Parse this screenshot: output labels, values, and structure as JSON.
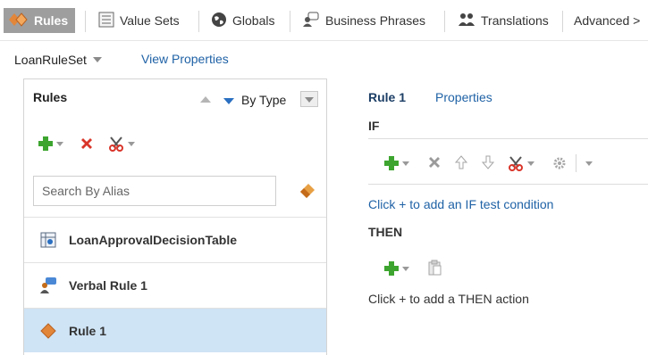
{
  "tabs": [
    {
      "label": "Rules",
      "icon": "rules-diamond-icon",
      "active": true
    },
    {
      "label": "Value Sets",
      "icon": "value-sets-icon"
    },
    {
      "label": "Globals",
      "icon": "globe-icon"
    },
    {
      "label": "Business Phrases",
      "icon": "business-phrases-icon"
    },
    {
      "label": "Translations",
      "icon": "translations-icon"
    },
    {
      "label": "Advanced >",
      "icon": ""
    }
  ],
  "ruleset": {
    "name": "LoanRuleSet",
    "view_properties": "View Properties"
  },
  "left_panel": {
    "title": "Rules",
    "sort_label": "By Type",
    "search_placeholder": "Search By Alias",
    "items": [
      {
        "label": "LoanApprovalDecisionTable",
        "icon": "decision-table-icon"
      },
      {
        "label": "Verbal Rule 1",
        "icon": "verbal-rule-icon"
      },
      {
        "label": "Rule 1",
        "icon": "rule-diamond-icon",
        "selected": true
      }
    ]
  },
  "right_panel": {
    "title": "Rule 1",
    "properties_link": "Properties",
    "if_label": "IF",
    "if_message": "Click + to add an IF test condition",
    "then_label": "THEN",
    "then_message": "Click + to add a THEN action"
  },
  "colors": {
    "accent": "#1f62a6",
    "selected_row": "#cfe4f5",
    "active_tab": "#9e9e9e",
    "add_green": "#3da52f",
    "delete_red": "#d9352a"
  }
}
